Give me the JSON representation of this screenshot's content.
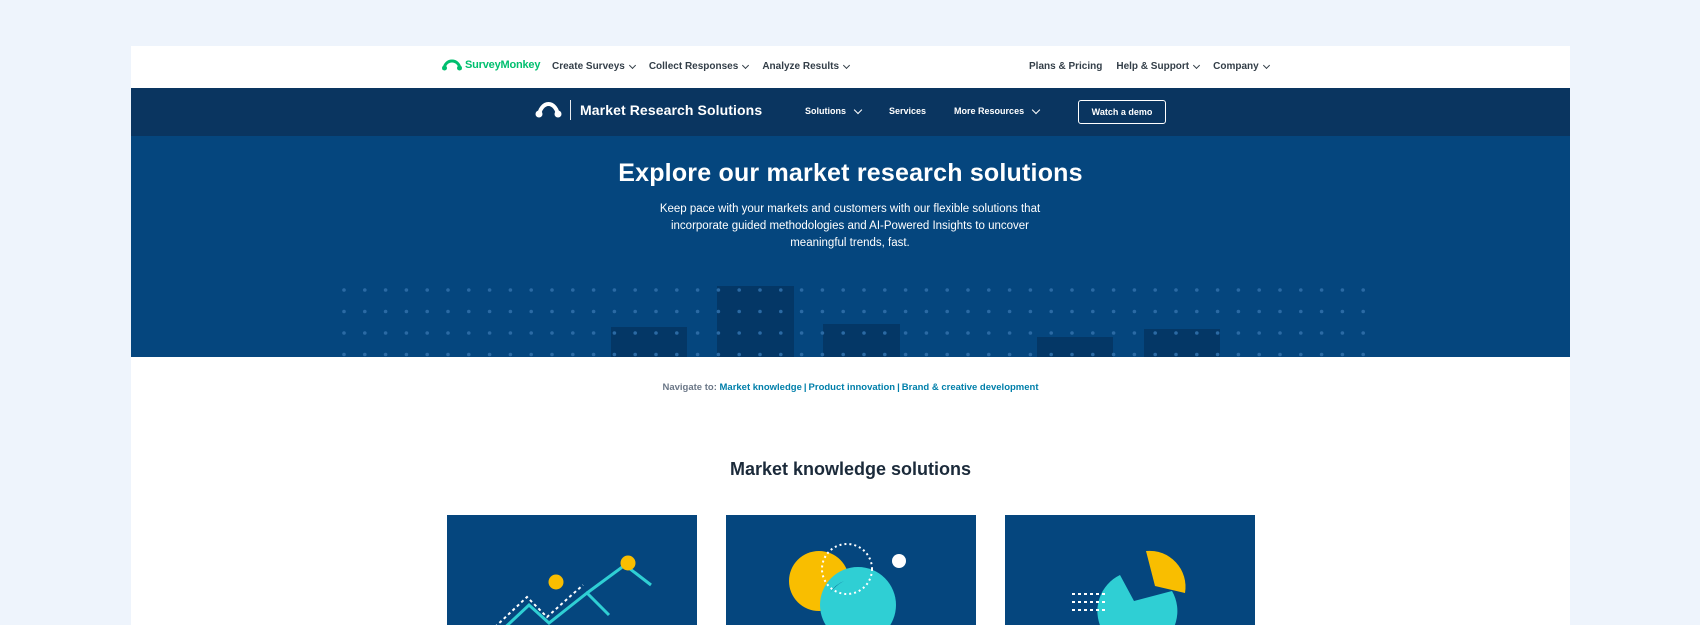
{
  "brand": {
    "name": "SurveyMonkey",
    "color": "#00bf6f",
    "logo_icon": "surveymonkey-logo-icon"
  },
  "global_nav": {
    "left": [
      {
        "label": "Create Surveys",
        "dropdown": true
      },
      {
        "label": "Collect Responses",
        "dropdown": true
      },
      {
        "label": "Analyze Results",
        "dropdown": true
      }
    ],
    "right": [
      {
        "label": "Plans & Pricing",
        "dropdown": false
      },
      {
        "label": "Help & Support",
        "dropdown": true
      },
      {
        "label": "Company",
        "dropdown": true
      }
    ]
  },
  "sub_nav": {
    "title": "Market Research Solutions",
    "links": [
      {
        "label": "Solutions",
        "dropdown": true
      },
      {
        "label": "Services",
        "dropdown": false
      },
      {
        "label": "More Resources",
        "dropdown": true
      }
    ],
    "demo_button": "Watch a demo",
    "background": "#0a3560"
  },
  "hero": {
    "title": "Explore our market research solutions",
    "description": "Keep pace with your markets and customers with our flexible solutions that incorporate guided methodologies and AI-Powered Insights to uncover meaningful trends, fast.",
    "background": "#05467e"
  },
  "navigate": {
    "label": "Navigate to:",
    "links": [
      "Market knowledge",
      "Product innovation",
      "Brand & creative development"
    ],
    "link_color": "#007faa"
  },
  "section": {
    "title": "Market knowledge solutions",
    "cards": [
      {
        "illustration": "trend-line-illustration"
      },
      {
        "illustration": "venn-circles-illustration"
      },
      {
        "illustration": "pie-chart-illustration"
      }
    ]
  },
  "colors": {
    "accent_yellow": "#f9be00",
    "accent_teal": "#2fcfd4",
    "page_bg": "#eef4fc"
  }
}
